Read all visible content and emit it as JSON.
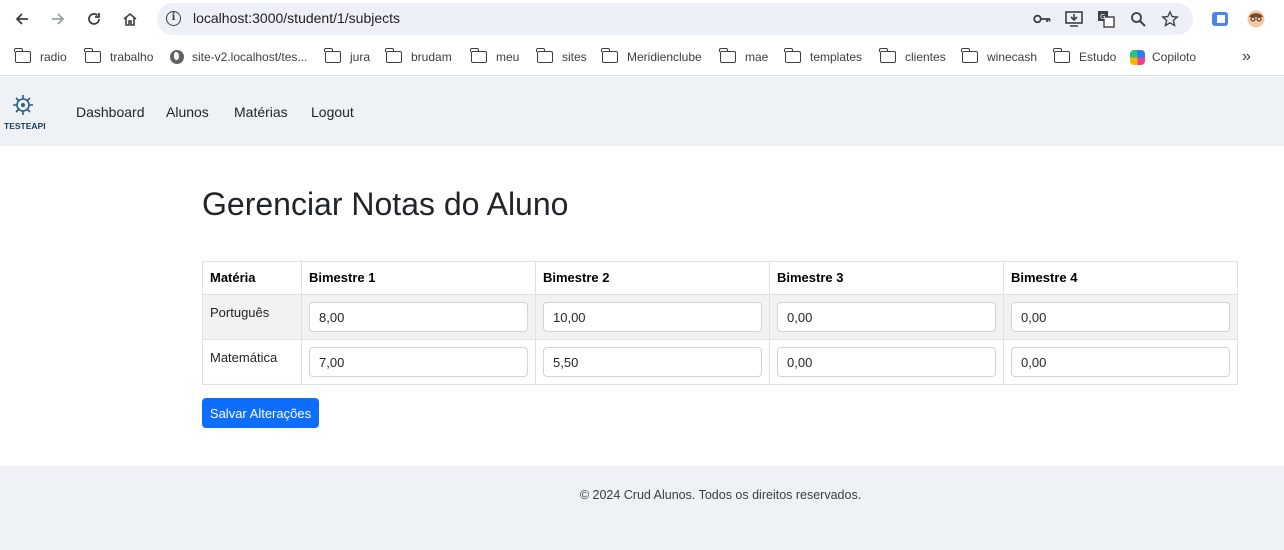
{
  "browser": {
    "url": "localhost:3000/student/1/subjects",
    "bookmarks": [
      "radio",
      "trabalho",
      "site-v2.localhost/tes...",
      "jura",
      "brudam",
      "meu",
      "sites",
      "Meridienclube",
      "mae",
      "templates",
      "clientes",
      "winecash",
      "Estudo",
      "Copiloto"
    ]
  },
  "app": {
    "logo_text": "TESTEAPI",
    "nav": [
      "Dashboard",
      "Alunos",
      "Matérias",
      "Logout"
    ],
    "colors": {
      "primary": "#0d6efd",
      "navbar_bg": "#eef1f5"
    }
  },
  "main": {
    "title": "Gerenciar Notas do Aluno",
    "table": {
      "headers": [
        "Matéria",
        "Bimestre 1",
        "Bimestre 2",
        "Bimestre 3",
        "Bimestre 4"
      ],
      "rows": [
        {
          "subject": "Português",
          "grades": [
            "8,00",
            "10,00",
            "0,00",
            "0,00"
          ]
        },
        {
          "subject": "Matemática",
          "grades": [
            "7,00",
            "5,50",
            "0,00",
            "0,00"
          ]
        }
      ]
    },
    "save_label": "Salvar Alterações"
  },
  "footer": {
    "text": "© 2024 Crud Alunos. Todos os direitos reservados."
  }
}
